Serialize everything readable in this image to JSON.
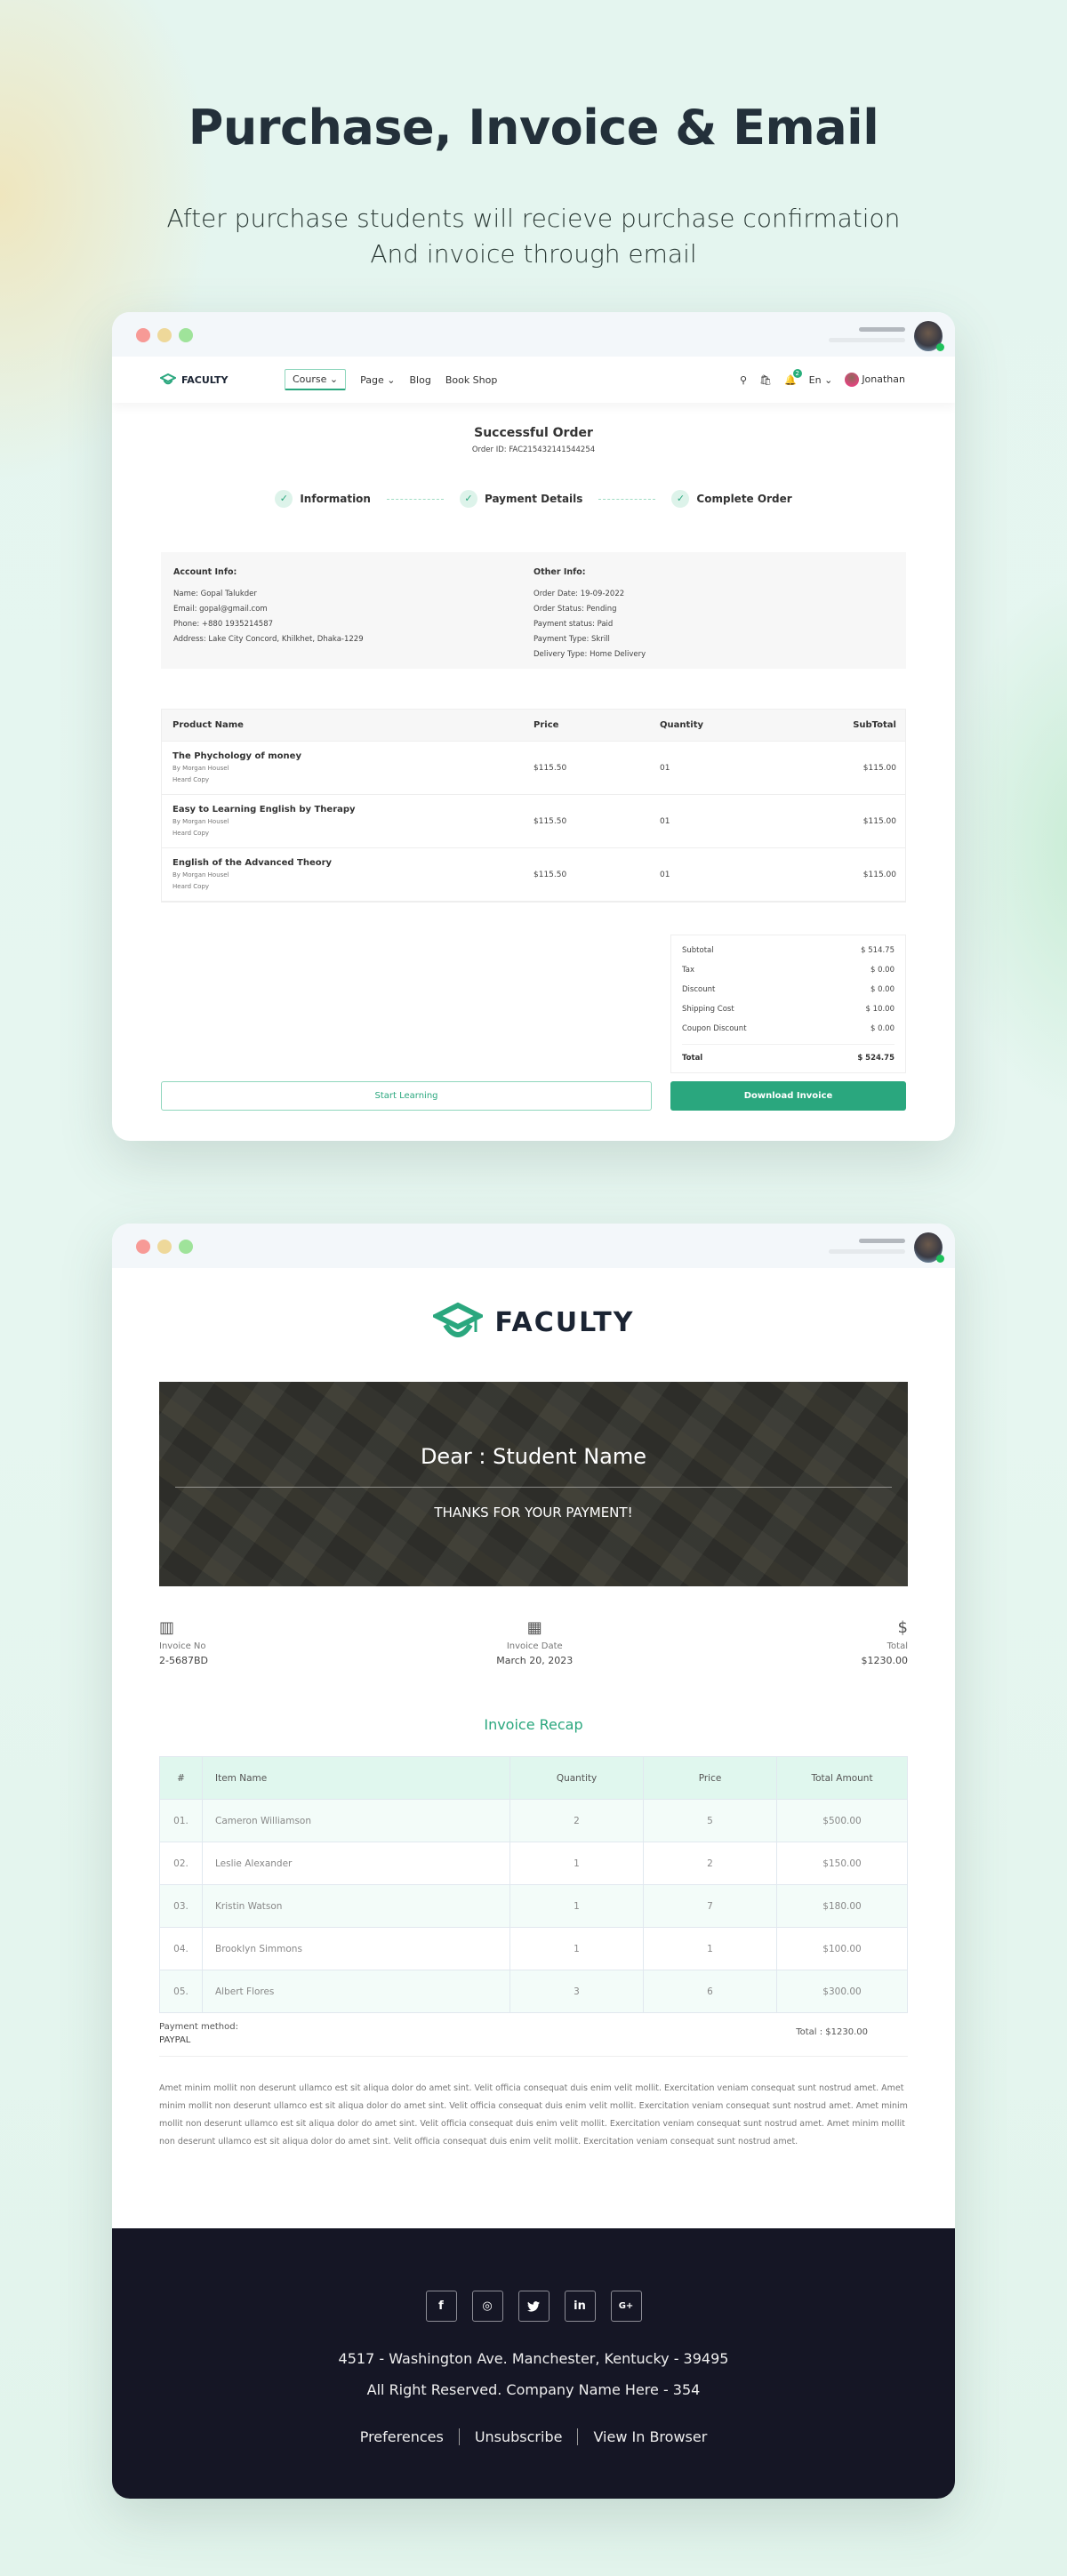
{
  "hero": {
    "title": "Purchase, Invoice & Email",
    "subtitle_line1": "After purchase students will recieve purchase confirmation",
    "subtitle_line2": "And invoice through email"
  },
  "order_page": {
    "nav": {
      "logo": "FACULTY",
      "menu": [
        "Course",
        "Page",
        "Blog",
        "Book Shop"
      ],
      "language": "En",
      "notification_count": "2",
      "user_name": "Jonathan"
    },
    "title": "Successful Order",
    "order_id": "Order ID: FAC215432141544254",
    "steps": [
      "Information",
      "Payment Details",
      "Complete Order"
    ],
    "account_info": {
      "heading": "Account Info:",
      "lines": [
        "Name: Gopal Talukder",
        "Email: gopal@gmail.com",
        "Phone: +880 1935214587",
        "Address: Lake City Concord, Khilkhet, Dhaka-1229"
      ]
    },
    "other_info": {
      "heading": "Other Info:",
      "lines": [
        "Order Date: 19-09-2022",
        "Order Status: Pending",
        "Payment status: Paid",
        "Payment Type: Skrill",
        "Delivery Type: Home Delivery"
      ]
    },
    "table": {
      "headers": [
        "Product Name",
        "Price",
        "Quantity",
        "SubTotal"
      ],
      "rows": [
        {
          "name": "The Phychology of money",
          "author": "By Morgan Housel",
          "type": "Heard Copy",
          "price": "$115.50",
          "qty": "01",
          "subtotal": "$115.00"
        },
        {
          "name": "Easy to Learning English by Therapy",
          "author": "By Morgan Housel",
          "type": "Heard Copy",
          "price": "$115.50",
          "qty": "01",
          "subtotal": "$115.00"
        },
        {
          "name": "English of the Advanced Theory",
          "author": "By Morgan Housel",
          "type": "Heard Copy",
          "price": "$115.50",
          "qty": "01",
          "subtotal": "$115.00"
        }
      ]
    },
    "totals": [
      {
        "label": "Subtotal",
        "value": "$ 514.75"
      },
      {
        "label": "Tax",
        "value": "$ 0.00"
      },
      {
        "label": "Discount",
        "value": "$ 0.00"
      },
      {
        "label": "Shipping Cost",
        "value": "$ 10.00"
      },
      {
        "label": "Coupon Discount",
        "value": "$ 0.00"
      }
    ],
    "grand_total": {
      "label": "Total",
      "value": "$ 524.75"
    },
    "start_learning": "Start Learning",
    "download_invoice": "Download Invoice"
  },
  "email": {
    "logo": "FACULTY",
    "dear": "Dear : Student Name",
    "thanks": "THANKS FOR YOUR PAYMENT!",
    "meta": [
      {
        "icon": "barcode-icon",
        "label": "Invoice No",
        "value": "2-5687BD"
      },
      {
        "icon": "calendar-icon",
        "label": "Invoice Date",
        "value": "March 20, 2023"
      },
      {
        "icon": "dollar-icon",
        "label": "Total",
        "value": "$1230.00"
      }
    ],
    "recap_title": "Invoice Recap",
    "recap_headers": [
      "#",
      "Item Name",
      "Quantity",
      "Price",
      "Total Amount"
    ],
    "recap_rows": [
      {
        "no": "01.",
        "name": "Cameron Williamson",
        "qty": "2",
        "price": "5",
        "total": "$500.00"
      },
      {
        "no": "02.",
        "name": "Leslie Alexander",
        "qty": "1",
        "price": "2",
        "total": "$150.00"
      },
      {
        "no": "03.",
        "name": "Kristin Watson",
        "qty": "1",
        "price": "7",
        "total": "$180.00"
      },
      {
        "no": "04.",
        "name": "Brooklyn Simmons",
        "qty": "1",
        "price": "1",
        "total": "$100.00"
      },
      {
        "no": "05.",
        "name": "Albert Flores",
        "qty": "3",
        "price": "6",
        "total": "$300.00"
      }
    ],
    "payment_method_label": "Payment method:",
    "payment_method": "PAYPAL",
    "total": "Total : $1230.00",
    "body_text": "Amet minim mollit non deserunt ullamco est sit aliqua dolor do amet sint. Velit officia consequat duis enim velit mollit. Exercitation veniam consequat sunt nostrud amet. Amet minim mollit non deserunt ullamco est sit aliqua dolor do amet sint. Velit officia consequat duis enim velit mollit. Exercitation veniam consequat sunt nostrud amet. Amet minim mollit non deserunt ullamco est sit aliqua dolor do amet sint. Velit officia consequat duis enim velit mollit. Exercitation veniam consequat sunt nostrud amet. Amet minim mollit non deserunt ullamco est sit aliqua dolor do amet sint. Velit officia consequat duis enim velit mollit. Exercitation veniam consequat sunt nostrud amet.",
    "footer": {
      "socials": [
        {
          "name": "facebook-icon",
          "glyph": "f"
        },
        {
          "name": "instagram-icon",
          "glyph": "◎"
        },
        {
          "name": "twitter-icon",
          "glyph": "🐦"
        },
        {
          "name": "linkedin-icon",
          "glyph": "in"
        },
        {
          "name": "google-plus-icon",
          "glyph": "G+"
        }
      ],
      "address": "4517 - Washington Ave. Manchester, Kentucky - 39495",
      "rights": "All Right Reserved. Company Name Here - 354",
      "links": [
        "Preferences",
        "Unsubscribe",
        "View In Browser"
      ]
    }
  },
  "colors": {
    "accent": "#2aa77e",
    "footer_bg": "#151625",
    "recap_header_bg": "#e0f7ee"
  }
}
